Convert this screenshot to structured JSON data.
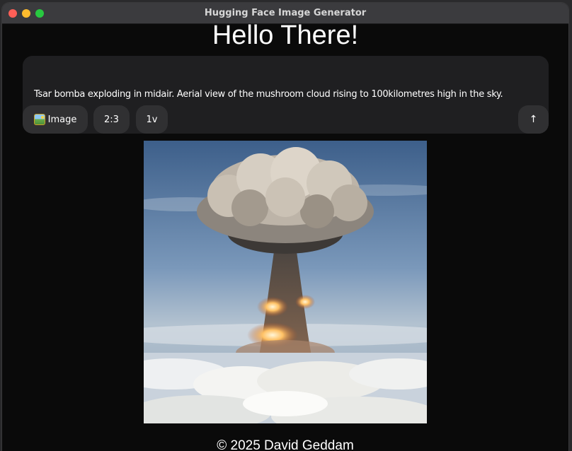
{
  "window": {
    "title": "Hugging Face Image Generator"
  },
  "main": {
    "heading": "Hello There!",
    "prompt": "Tsar bomba exploding in midair. Aerial view of the mushroom cloud rising to 100kilometres high in the sky.",
    "chips": {
      "image_label": "Image",
      "image_icon": "framed-picture-icon",
      "ratio_label": "2:3",
      "version_label": "1v",
      "send_icon": "arrow-up-icon",
      "send_glyph": "↑"
    }
  },
  "footer": {
    "copyright": "© 2025 David Geddam"
  },
  "colors": {
    "background": "#0a0a0a",
    "card": "#1f1f21",
    "chip": "#303032",
    "titlebar": "#3b3b3e"
  }
}
